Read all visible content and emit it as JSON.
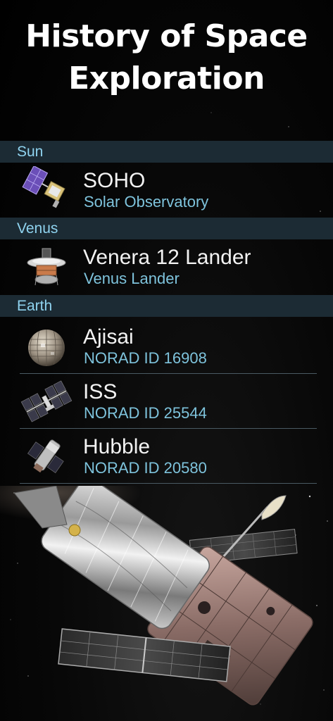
{
  "page": {
    "title_line1": "History of Space",
    "title_line2": "Exploration"
  },
  "sections": [
    {
      "header": "Sun",
      "items": [
        {
          "name": "SOHO",
          "subtitle": "Solar Observatory",
          "icon": "soho-satellite-icon"
        }
      ]
    },
    {
      "header": "Venus",
      "items": [
        {
          "name": "Venera 12 Lander",
          "subtitle": "Venus Lander",
          "icon": "venera-lander-icon"
        }
      ]
    },
    {
      "header": "Earth",
      "items": [
        {
          "name": "Ajisai",
          "subtitle": "NORAD ID 16908",
          "icon": "ajisai-satellite-icon"
        },
        {
          "name": "ISS",
          "subtitle": "NORAD ID 25544",
          "icon": "iss-icon"
        },
        {
          "name": "Hubble",
          "subtitle": "NORAD ID 20580",
          "icon": "hubble-icon"
        }
      ]
    }
  ],
  "colors": {
    "header_bg": "#1c2b34",
    "header_text": "#8fd3ef",
    "subtitle_text": "#7ec3dc",
    "title_text": "#ffffff"
  }
}
